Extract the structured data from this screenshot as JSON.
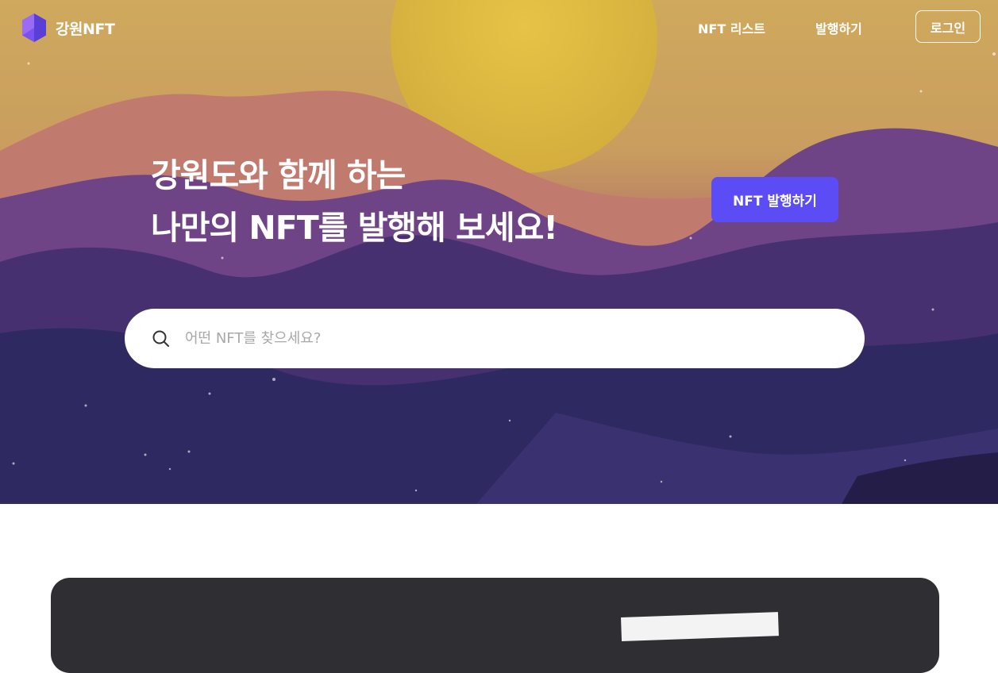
{
  "brand": {
    "name": "강원NFT",
    "logo_color": "#6a4cf5"
  },
  "nav": {
    "links": [
      "NFT 리스트",
      "발행하기"
    ],
    "login_label": "로그인"
  },
  "hero": {
    "headline_line1": "강원도와 함께 하는",
    "headline_line2": "나만의 NFT를 발행해 보세요!",
    "cta_label": "NFT 발행하기",
    "accent_color": "#5b4cf5"
  },
  "search": {
    "placeholder": "어떤 NFT를 찾으세요?",
    "icon": "search-icon"
  }
}
